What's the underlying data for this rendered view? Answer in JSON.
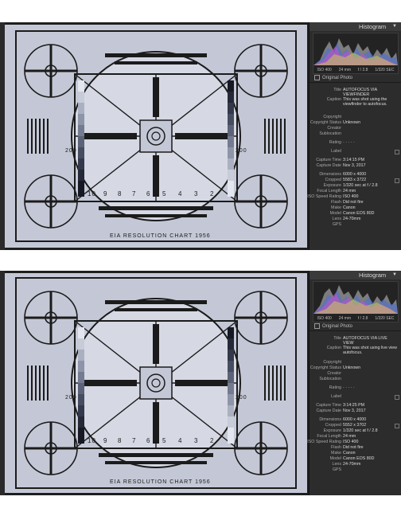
{
  "screenshots": [
    {
      "panel": {
        "histogram_title": "Histogram",
        "histogram_info": [
          "ISO 400",
          "24 mm",
          "f / 2.8",
          "1/320 SEC"
        ],
        "original_photo": "Original Photo",
        "rows": [
          {
            "k": "Title",
            "v": "AUTOFOCUS VIA VIEWFINDER"
          },
          {
            "k": "Caption",
            "v": "This was shot using the viewfinder to autofocus."
          },
          {
            "k": "Copyright",
            "v": ""
          },
          {
            "k": "Copyright Status",
            "v": "Unknown"
          },
          {
            "k": "Creator",
            "v": ""
          },
          {
            "k": "Sublocation",
            "v": ""
          },
          {
            "k": "Rating",
            "v": "· · · · ·"
          },
          {
            "k": "Label",
            "v": ""
          },
          {
            "k": "Capture Time",
            "v": "3:14:15 PM"
          },
          {
            "k": "Capture Date",
            "v": "Nov 3, 2017"
          },
          {
            "k": "Dimensions",
            "v": "6000 x 4000"
          },
          {
            "k": "Cropped",
            "v": "5583 x 3722"
          },
          {
            "k": "Exposure",
            "v": "1/320 sec at f / 2.8"
          },
          {
            "k": "Focal Length",
            "v": "24 mm"
          },
          {
            "k": "ISO Speed Rating",
            "v": "ISO 400"
          },
          {
            "k": "Flash",
            "v": "Did not fire"
          },
          {
            "k": "Make",
            "v": "Canon"
          },
          {
            "k": "Model",
            "v": "Canon EOS 80D"
          },
          {
            "k": "Lens",
            "v": "24-70mm"
          },
          {
            "k": "GPS",
            "v": ""
          }
        ]
      },
      "chart_caption": "EIA RESOLUTION CHART 1956",
      "numbers": {
        "n200a": "200",
        "n200b": "200",
        "n10": "10",
        "n9": "9",
        "n8": "8",
        "n7": "7",
        "n6": "6",
        "n5": "5",
        "n4": "4",
        "n3": "3",
        "n2": "2"
      }
    },
    {
      "panel": {
        "histogram_title": "Histogram",
        "histogram_info": [
          "ISO 400",
          "24 mm",
          "f / 2.8",
          "1/320 SEC"
        ],
        "original_photo": "Original Photo",
        "rows": [
          {
            "k": "Title",
            "v": "AUTOFOCUS VIA LIVE VIEW"
          },
          {
            "k": "Caption",
            "v": "This was shot using live view autofocus."
          },
          {
            "k": "Copyright",
            "v": ""
          },
          {
            "k": "Copyright Status",
            "v": "Unknown"
          },
          {
            "k": "Creator",
            "v": ""
          },
          {
            "k": "Sublocation",
            "v": ""
          },
          {
            "k": "Rating",
            "v": "· · · · ·"
          },
          {
            "k": "Label",
            "v": ""
          },
          {
            "k": "Capture Time",
            "v": "3:14:25 PM"
          },
          {
            "k": "Capture Date",
            "v": "Nov 3, 2017"
          },
          {
            "k": "Dimensions",
            "v": "6000 x 4000"
          },
          {
            "k": "Cropped",
            "v": "5552 x 3702"
          },
          {
            "k": "Exposure",
            "v": "1/320 sec at f / 2.8"
          },
          {
            "k": "Focal Length",
            "v": "24 mm"
          },
          {
            "k": "ISO Speed Rating",
            "v": "ISO 400"
          },
          {
            "k": "Flash",
            "v": "Did not fire"
          },
          {
            "k": "Make",
            "v": "Canon"
          },
          {
            "k": "Model",
            "v": "Canon EOS 80D"
          },
          {
            "k": "Lens",
            "v": "24-70mm"
          },
          {
            "k": "GPS",
            "v": ""
          }
        ]
      },
      "chart_caption": "EIA RESOLUTION CHART 1956",
      "numbers": {
        "n200a": "200",
        "n200b": "200",
        "n10": "10",
        "n9": "9",
        "n8": "8",
        "n7": "7",
        "n6": "6",
        "n5": "5",
        "n4": "4",
        "n3": "3",
        "n2": "2"
      }
    }
  ],
  "colors": {
    "panel_bg": "#2c2c2c",
    "chart_bg": "#c4c8d6",
    "chart_ink": "#1b1b1b"
  }
}
